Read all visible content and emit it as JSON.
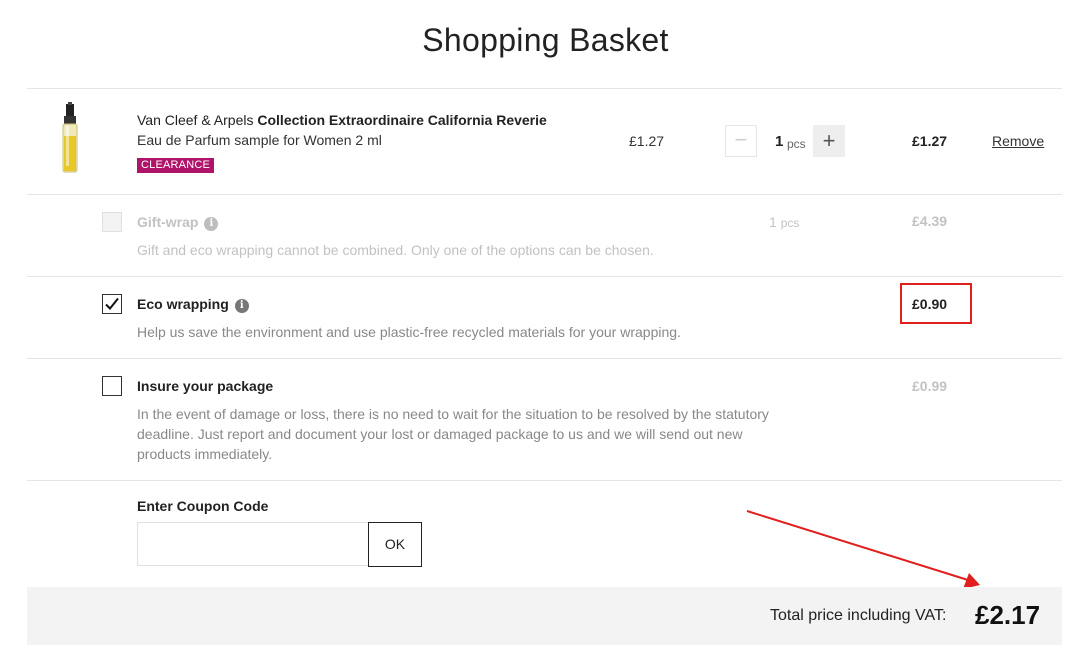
{
  "page": {
    "title": "Shopping Basket"
  },
  "product": {
    "brand": "Van Cleef & Arpels",
    "name": "Collection Extraordinaire California Reverie",
    "subtitle": "Eau de Parfum sample for Women 2 ml",
    "badge": "CLEARANCE",
    "unit_price": "£1.27",
    "quantity": "1",
    "quantity_unit": "pcs",
    "minus_label": "−",
    "plus_label": "+",
    "line_total": "£1.27",
    "remove_label": "Remove"
  },
  "options": {
    "gift_wrap": {
      "title": "Gift-wrap",
      "checked": false,
      "disabled": true,
      "description": "Gift and eco wrapping cannot be combined. Only one of the options can be chosen.",
      "quantity": "1",
      "quantity_unit": "pcs",
      "price": "£4.39"
    },
    "eco_wrapping": {
      "title": "Eco wrapping",
      "checked": true,
      "description": "Help us save the environment and use plastic-free recycled materials for your wrapping.",
      "price": "£0.90"
    },
    "insurance": {
      "title": "Insure your package",
      "checked": false,
      "description": "In the event of damage or loss, there is no need to wait for the situation to be resolved by the statutory deadline. Just report and document your lost or damaged package to us and we will send out new products immediately.",
      "price": "£0.99"
    }
  },
  "coupon": {
    "label": "Enter Coupon Code",
    "value": "",
    "placeholder": "",
    "button_label": "OK"
  },
  "total": {
    "label": "Total price including VAT:",
    "value": "£2.17"
  },
  "colors": {
    "badge": "#b0136a",
    "annotation": "#e0201f",
    "total_bar": "#f3f3f3"
  },
  "icons": {
    "info": "info-icon",
    "check": "checkmark-icon",
    "annotation": "annotation-arrow"
  }
}
